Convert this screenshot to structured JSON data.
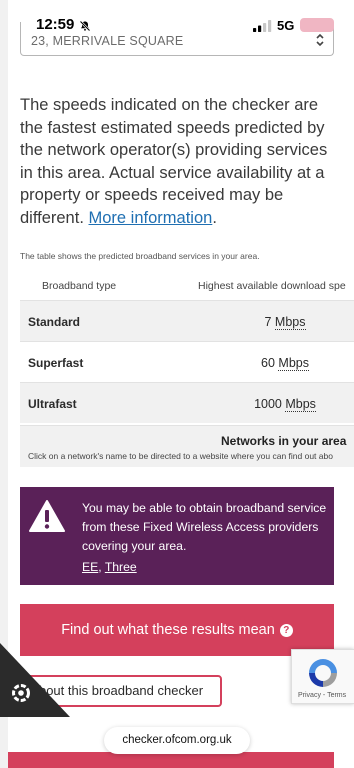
{
  "status_bar": {
    "time": "12:59",
    "network": "5G"
  },
  "address": {
    "selected": "23, MERRIVALE SQUARE"
  },
  "disclaimer": {
    "text": "The speeds indicated on the checker are the fastest estimated speeds predicted by the network operator(s) providing services in this area. Actual service availability at a property or speeds received may be different.",
    "link": "More information",
    "end": "."
  },
  "table": {
    "caption": "The table shows the predicted broadband services in your area.",
    "headers": [
      "Broadband type",
      "Highest available download spe"
    ],
    "rows": [
      {
        "type": "Standard",
        "speed": "7",
        "unit": "Mbps"
      },
      {
        "type": "Superfast",
        "speed": "60",
        "unit": "Mbps"
      },
      {
        "type": "Ultrafast",
        "speed": "1000",
        "unit": "Mbps"
      }
    ],
    "networks_title": "Networks in your area",
    "networks_hint": "Click on a network's name to be directed to a website where you can find out abo"
  },
  "fwa_notice": {
    "text": "You may be able to obtain broadband service from these Fixed Wireless Access providers covering your area.",
    "providers": [
      "EE",
      "Three"
    ],
    "separator": ", "
  },
  "buttons": {
    "results": "Find out what these results mean",
    "help_glyph": "?",
    "about": "bout this broadband checker"
  },
  "recaptcha": {
    "privacy": "Privacy",
    "separator": " - ",
    "terms": "Terms"
  },
  "browser": {
    "url": "checker.ofcom.org.uk"
  },
  "colors": {
    "accent": "#d4405c",
    "notice": "#5a2158",
    "link": "#1f6fb2"
  },
  "icons": {
    "bell": "bell-slash-icon",
    "signal": "signal-bars-icon",
    "battery": "battery-icon",
    "chevron": "chevron-updown-icon",
    "warning": "warning-triangle-icon",
    "help": "question-circle-icon",
    "recaptcha": "recaptcha-logo-icon",
    "cookie": "cookie-settings-icon"
  }
}
